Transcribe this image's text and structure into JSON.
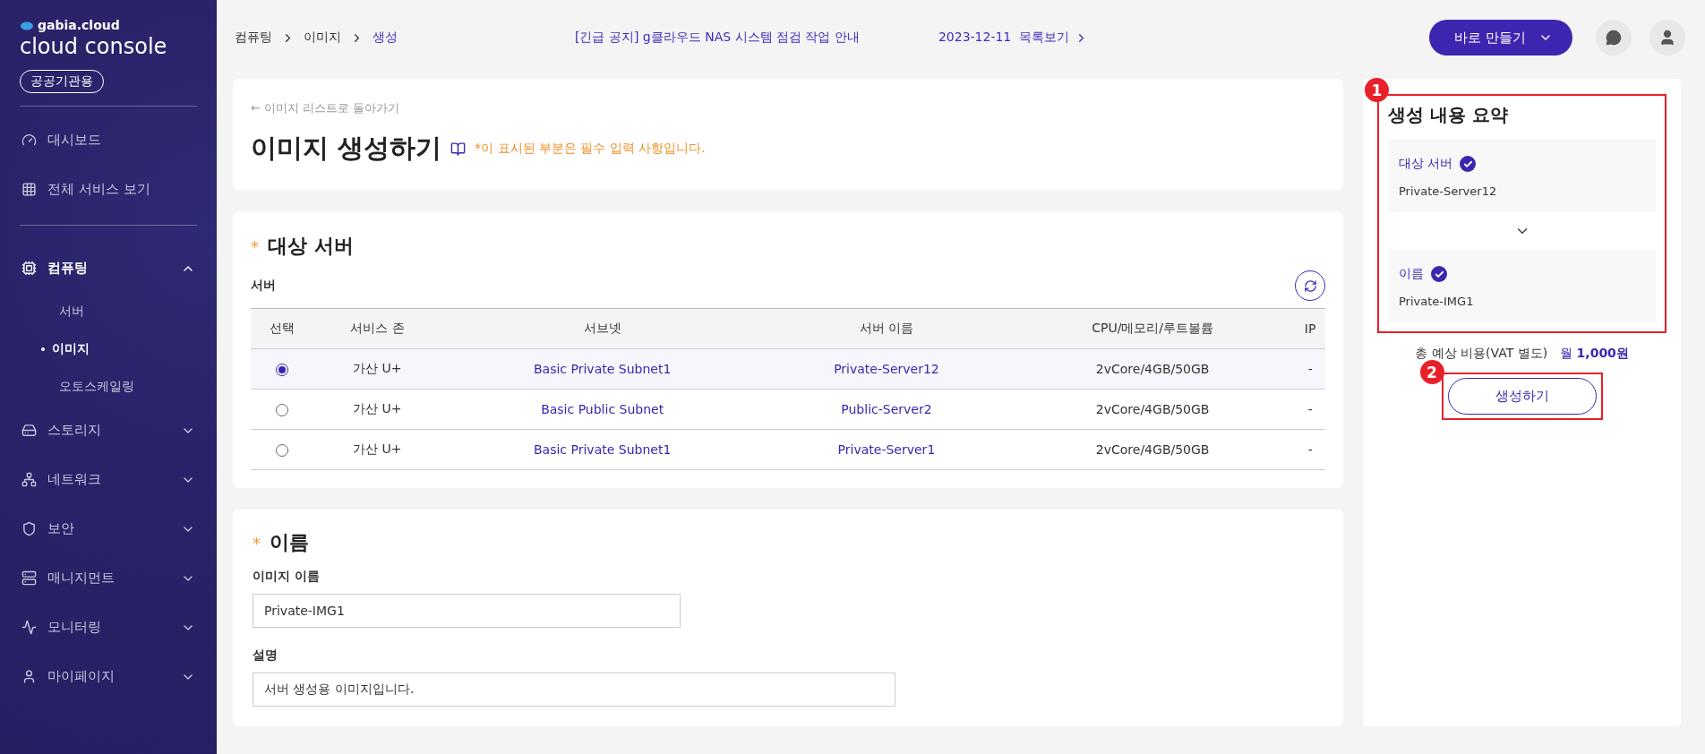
{
  "sidebar": {
    "logo_small": "gabia.cloud",
    "logo_title": "cloud console",
    "badge": "공공기관용",
    "top_items": [
      {
        "label": "대시보드"
      },
      {
        "label": "전체 서비스 보기"
      }
    ],
    "menu": [
      {
        "label": "컴퓨팅",
        "expanded": true,
        "children": [
          {
            "label": "서버",
            "selected": false
          },
          {
            "label": "이미지",
            "selected": true
          },
          {
            "label": "오토스케일링",
            "selected": false
          }
        ]
      },
      {
        "label": "스토리지",
        "expanded": false
      },
      {
        "label": "네트워크",
        "expanded": false
      },
      {
        "label": "보안",
        "expanded": false
      },
      {
        "label": "매니지먼트",
        "expanded": false
      },
      {
        "label": "모니터링",
        "expanded": false
      },
      {
        "label": "마이페이지",
        "expanded": false
      }
    ]
  },
  "topbar": {
    "breadcrumbs": [
      "컴퓨팅",
      "이미지",
      "생성"
    ],
    "notice": "[긴급 공지] g클라우드 NAS 시스템 점검 작업 안내",
    "notice_date": "2023-12-11",
    "notice_list": "목록보기",
    "create_button": "바로 만들기"
  },
  "header": {
    "back_link": "← 이미지 리스트로 돌아가기",
    "title": "이미지 생성하기",
    "required_note": "*이 표시된 부분은 필수 입력 사항입니다."
  },
  "server_section": {
    "required_mark": "*",
    "title": "대상 서버",
    "label": "서버",
    "table": {
      "columns": [
        "선택",
        "서비스 존",
        "서브넷",
        "서버 이름",
        "CPU/메모리/루트볼륨",
        "IP"
      ],
      "rows": [
        {
          "selected": true,
          "zone": "가산 U+",
          "subnet": "Basic Private Subnet1",
          "name": "Private-Server12",
          "spec": "2vCore/4GB/50GB",
          "ip": "-"
        },
        {
          "selected": false,
          "zone": "가산 U+",
          "subnet": "Basic Public Subnet",
          "name": "Public-Server2",
          "spec": "2vCore/4GB/50GB",
          "ip": "-"
        },
        {
          "selected": false,
          "zone": "가산 U+",
          "subnet": "Basic Private Subnet1",
          "name": "Private-Server1",
          "spec": "2vCore/4GB/50GB",
          "ip": "-"
        }
      ]
    }
  },
  "name_section": {
    "required_mark": "*",
    "title": "이름",
    "fields": [
      {
        "label": "이미지 이름",
        "value": "Private-IMG1"
      },
      {
        "label": "설명",
        "value": "서버 생성용 이미지입니다."
      }
    ]
  },
  "summary": {
    "title": "생성 내용 요약",
    "items": [
      {
        "label": "대상 서버",
        "value": "Private-Server12",
        "done": true
      },
      {
        "label": "이름",
        "value": "Private-IMG1",
        "done": true
      }
    ],
    "cost_label": "총 예상 비용(VAT 별도)",
    "cost_value": "월 **1,000원**",
    "submit": "생성하기"
  },
  "annotations": [
    "1",
    "2"
  ]
}
